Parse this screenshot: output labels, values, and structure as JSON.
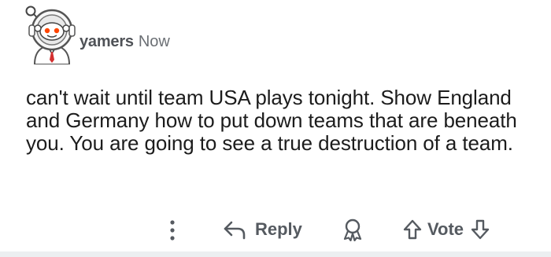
{
  "comment": {
    "username": "yamers",
    "timestamp": "Now",
    "body": "can't wait until team USA plays tonight. Show England and Germany how to put down teams that are beneath you. You are going to see a true destruction of a team.",
    "avatar_icon": "snoo-astronaut-avatar"
  },
  "actions": {
    "more_icon": "vertical-ellipsis-icon",
    "reply_icon": "reply-arrow-icon",
    "reply_label": "Reply",
    "award_icon": "award-icon",
    "upvote_icon": "upvote-arrow-icon",
    "vote_label": "Vote",
    "downvote_icon": "downvote-arrow-icon"
  },
  "colors": {
    "text": "#1c1c1c",
    "muted": "#555a60",
    "snoo_red": "#ff4500",
    "divider": "#eceff1"
  }
}
